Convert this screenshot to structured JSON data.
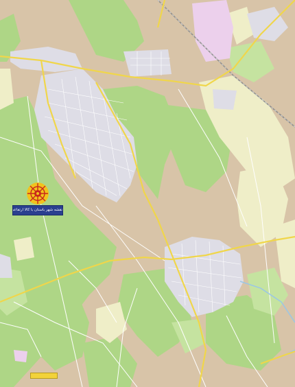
{
  "map": {
    "title": "نقشه شهر باستان با کالا ارتفاعی",
    "credit_text": "",
    "colors": {
      "background": "#d8c4a8",
      "farmland": "#aed686",
      "orchard": "#c5e3a0",
      "meadow": "#efeec8",
      "urban": "#dedde6",
      "industrial": "#ecd0ec",
      "road_major": "#f0d64a",
      "road_minor": "#ffffff",
      "railway": "#8a8a8a",
      "water": "#9ac6e6",
      "emblem_red": "#c8281c",
      "emblem_gold": "#f2c21c",
      "banner": "#2a3f8f"
    }
  }
}
